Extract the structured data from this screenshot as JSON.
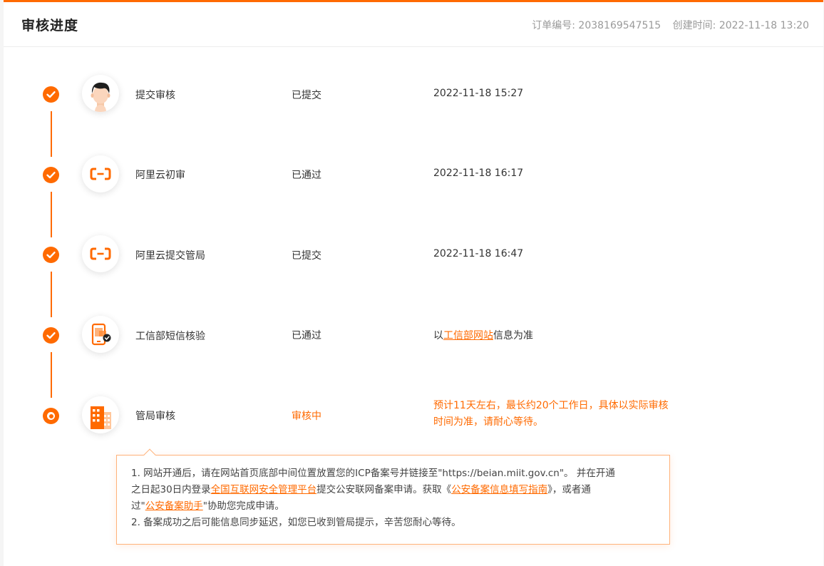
{
  "header": {
    "title": "审核进度",
    "order_label": "订单编号: 2038169547515",
    "created_label": "创建时间: 2022-11-18 13:20"
  },
  "steps": [
    {
      "name": "提交审核",
      "status": "已提交",
      "time": "2022-11-18 15:27",
      "icon": "user-avatar-icon"
    },
    {
      "name": "阿里云初审",
      "status": "已通过",
      "time": "2022-11-18 16:17",
      "icon": "aliyun-logo-icon"
    },
    {
      "name": "阿里云提交管局",
      "status": "已提交",
      "time": "2022-11-18 16:47",
      "icon": "aliyun-logo-icon"
    },
    {
      "name": "工信部短信核验",
      "status": "已通过",
      "note_prefix": "以",
      "note_link": "工信部网站",
      "note_suffix": "信息为准",
      "icon": "phone-verify-icon"
    },
    {
      "name": "管局审核",
      "status": "审核中",
      "note": "预计11天左右，最长约20个工作日，具体以实际审核时间为准，请耐心等待。",
      "icon": "building-icon"
    }
  ],
  "tip": {
    "p1_a": "1. 网站开通后，请在网站首页底部中间位置放置您的ICP备案号并链接至\"https://beian.miit.gov.cn\"。 并在开通",
    "p1_b": "之日起30日内登录",
    "link1": "全国互联网安全管理平台",
    "p1_c": "提交公安联网备案申请。获取《",
    "link2": "公安备案信息填写指南",
    "p1_d": "》，或者通",
    "p1_e": "过\"",
    "link3": "公安备案助手",
    "p1_f": "\"协助您完成申请。",
    "p2": "2. 备案成功之后可能信息同步延迟，如您已收到管局提示，辛苦您耐心等待。"
  },
  "colors": {
    "accent": "#ff6a00",
    "text": "#333333",
    "muted": "#9a9a9a"
  }
}
